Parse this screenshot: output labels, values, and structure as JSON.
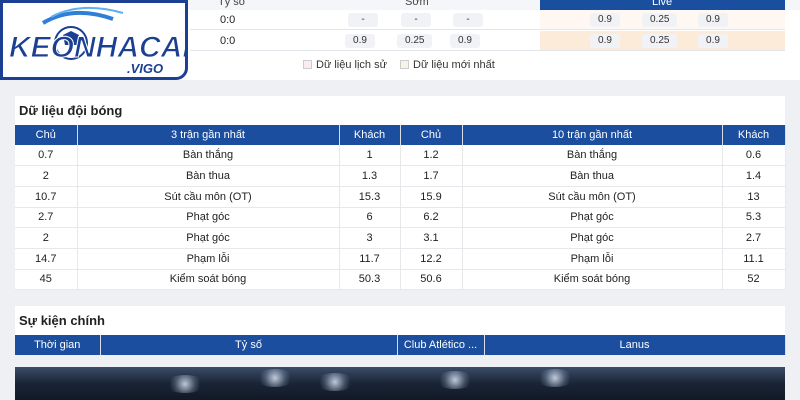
{
  "odds_header": {
    "score_label": "Tỷ số",
    "early_label": "Sớm",
    "live_label": "Live"
  },
  "odds_rows": [
    {
      "score": "0:0",
      "early": [
        "-",
        "-",
        "-"
      ],
      "live": [
        "0.9",
        "0.25",
        "0.9"
      ]
    },
    {
      "score": "0:0",
      "early": [
        "0.9",
        "0.25",
        "0.9"
      ],
      "live": [
        "0.9",
        "0.25",
        "0.9"
      ]
    }
  ],
  "legend": {
    "history": "Dữ liệu lịch sử",
    "latest": "Dữ liệu mới nhất"
  },
  "logo": {
    "brand": "KEONHACAI",
    "sub": ".VIGO"
  },
  "team_data": {
    "title": "Dữ liệu đội bóng",
    "headers": [
      "Chủ",
      "3 trận gần nhất",
      "Khách",
      "Chủ",
      "10 trận gần nhất",
      "Khách"
    ],
    "rows": [
      [
        "0.7",
        "Bàn thắng",
        "1",
        "1.2",
        "Bàn thắng",
        "0.6"
      ],
      [
        "2",
        "Bàn thua",
        "1.3",
        "1.7",
        "Bàn thua",
        "1.4"
      ],
      [
        "10.7",
        "Sút cầu môn (OT)",
        "15.3",
        "15.9",
        "Sút cầu môn (OT)",
        "13"
      ],
      [
        "2.7",
        "Phạt góc",
        "6",
        "6.2",
        "Phạt góc",
        "5.3"
      ],
      [
        "2",
        "Phạt góc",
        "3",
        "3.1",
        "Phạt góc",
        "2.7"
      ],
      [
        "14.7",
        "Phạm lỗi",
        "11.7",
        "12.2",
        "Phạm lỗi",
        "11.1"
      ],
      [
        "45",
        "Kiểm soát bóng",
        "50.3",
        "50.6",
        "Kiểm soát bóng",
        "52"
      ]
    ]
  },
  "events": {
    "title": "Sự kiện chính",
    "headers": [
      "Thời gian",
      "Tỷ số",
      "Club Atlético ...",
      "Lanus"
    ]
  },
  "colors": {
    "header_blue": "#1b4e9e",
    "live_blue": "#1a4fa0",
    "logo_blue": "#1b3f93"
  }
}
